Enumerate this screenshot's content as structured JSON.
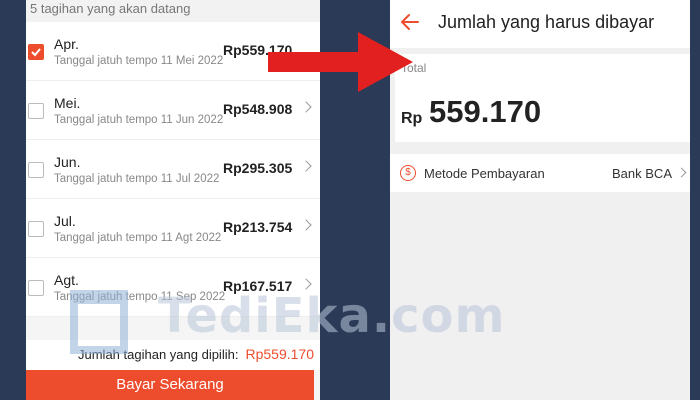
{
  "left": {
    "header": "5 tagihan yang akan datang",
    "bills": [
      {
        "month": "Apr.",
        "due": "Tanggal jatuh tempo 11 Mei 2022",
        "amount": "Rp559.170",
        "checked": true
      },
      {
        "month": "Mei.",
        "due": "Tanggal jatuh tempo 11 Jun 2022",
        "amount": "Rp548.908",
        "checked": false
      },
      {
        "month": "Jun.",
        "due": "Tanggal jatuh tempo 11 Jul 2022",
        "amount": "Rp295.305",
        "checked": false
      },
      {
        "month": "Jul.",
        "due": "Tanggal jatuh tempo 11 Agt 2022",
        "amount": "Rp213.754",
        "checked": false
      },
      {
        "month": "Agt.",
        "due": "Tanggal jatuh tempo 11 Sep 2022",
        "amount": "Rp167.517",
        "checked": false
      }
    ],
    "selected_label": "Jumlah tagihan yang dipilih:",
    "selected_amount": "Rp559.170",
    "pay_button": "Bayar Sekarang"
  },
  "right": {
    "title": "Jumlah yang harus dibayar",
    "total_label": "Total",
    "currency": "Rp",
    "total_value": "559.170",
    "method_label": "Metode Pembayaran",
    "method_value": "Bank BCA"
  },
  "watermark": "TediEka.com",
  "colors": {
    "accent": "#ee4d2d",
    "background": "#2b3a57",
    "arrow": "#e32020"
  },
  "icons": [
    "check-icon",
    "chevron-right-icon",
    "back-arrow-icon",
    "dollar-circle-icon"
  ]
}
